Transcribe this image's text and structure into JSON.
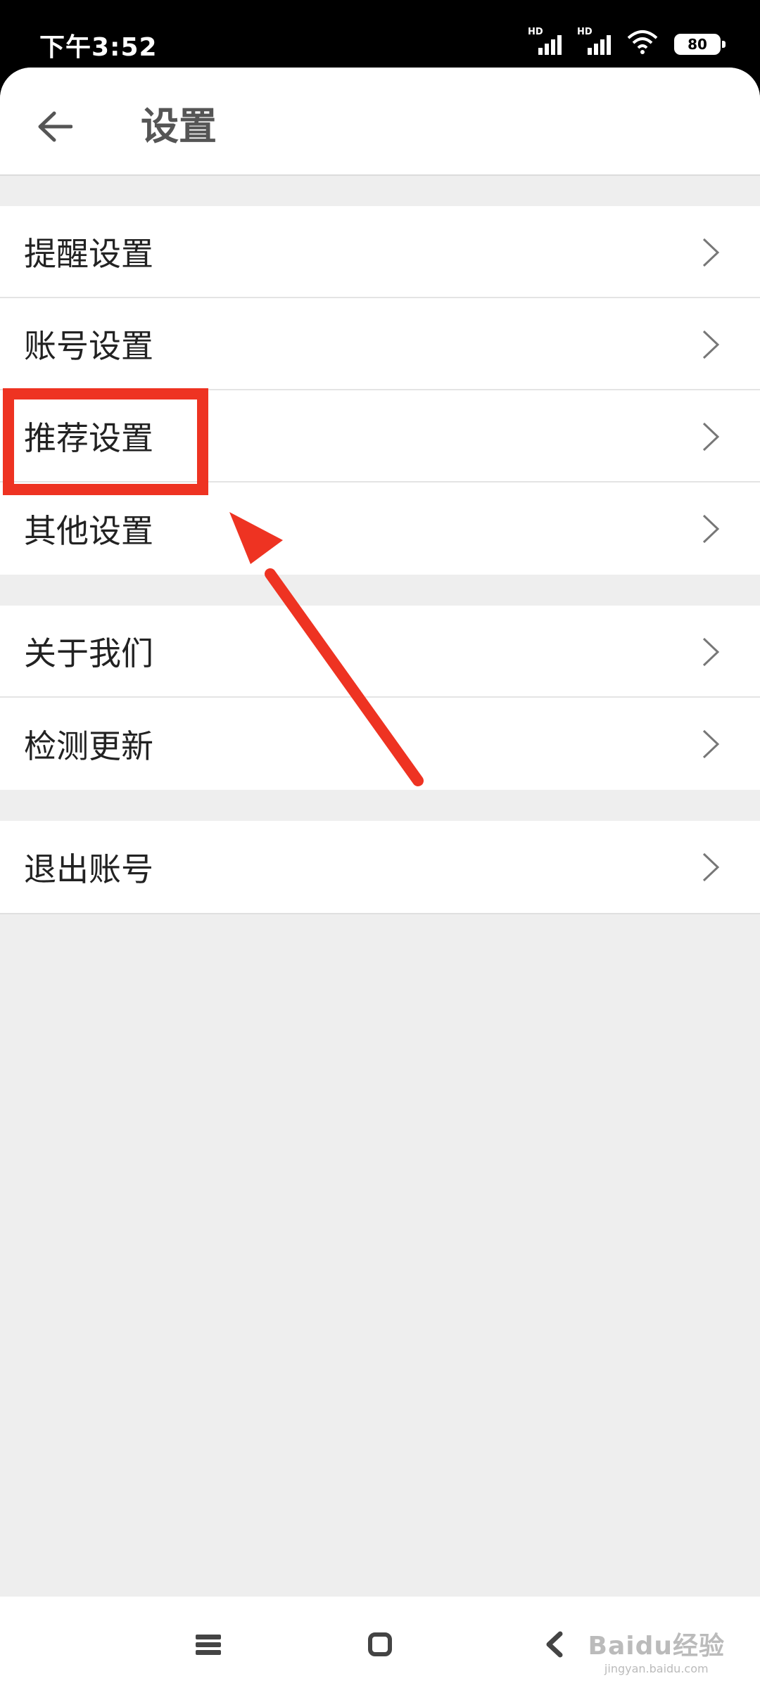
{
  "status_bar": {
    "time": "下午3:52",
    "signal_1_label": "HD",
    "signal_2_label": "HD",
    "battery": "80"
  },
  "header": {
    "title": "设置"
  },
  "menu_groups": [
    {
      "items": [
        "提醒设置",
        "账号设置",
        "推荐设置",
        "其他设置"
      ]
    },
    {
      "items": [
        "关于我们",
        "检测更新"
      ]
    },
    {
      "items": [
        "退出账号"
      ]
    }
  ],
  "watermark": {
    "logo": "Baidu经验",
    "url": "jingyan.baidu.com"
  },
  "colors": {
    "annotation": "#ee3322",
    "background": "#eeeeee",
    "text": "#222222"
  }
}
